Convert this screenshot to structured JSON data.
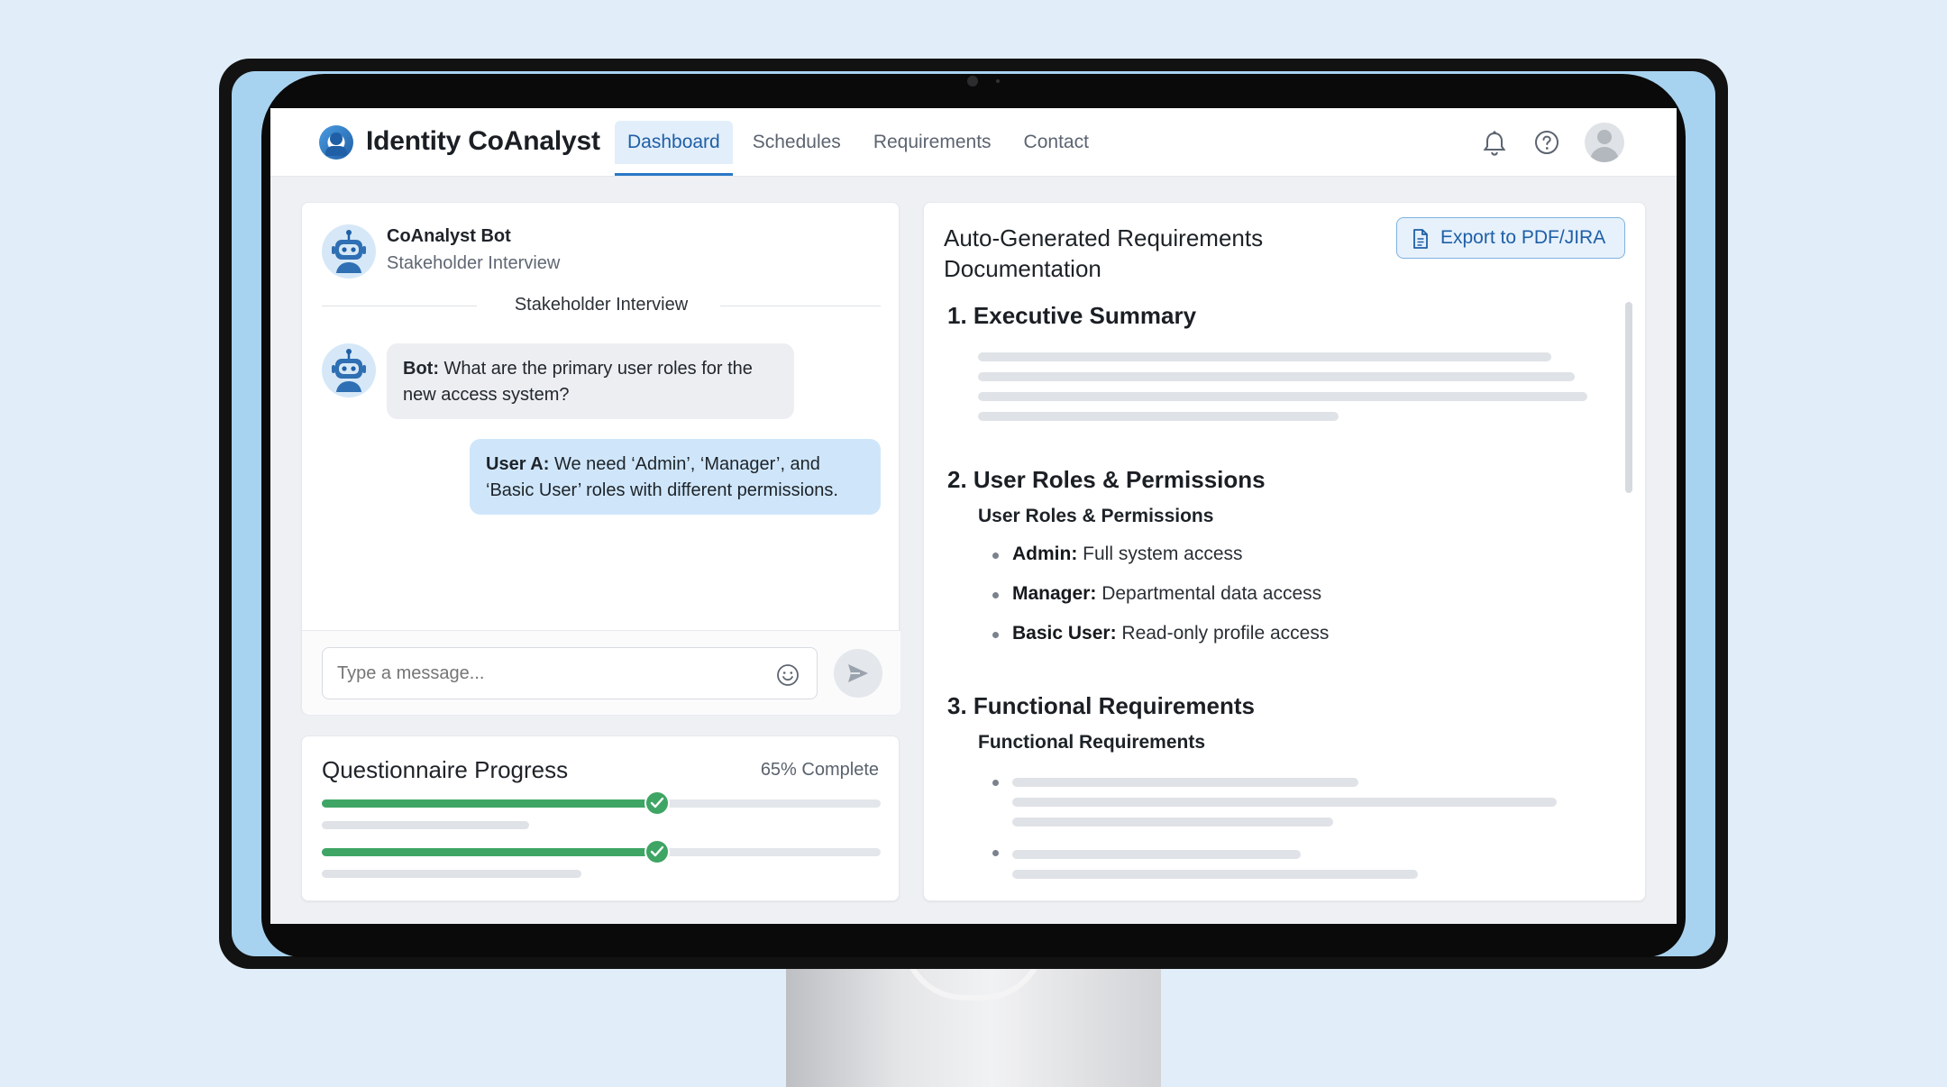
{
  "app": {
    "title": "Identity CoAnalyst",
    "tabs": [
      "Dashboard",
      "Schedules",
      "Requirements",
      "Contact"
    ],
    "active_tab": "Dashboard"
  },
  "chat": {
    "bot_name": "CoAnalyst Bot",
    "bot_subtitle": "Stakeholder Interview",
    "divider_label": "Stakeholder Interview",
    "messages": [
      {
        "speaker": "Bot:",
        "text": " What are the primary user roles for the new access system?"
      },
      {
        "speaker": "User A:",
        "text": " We need ‘Admin’, ‘Manager’, and ‘Basic User’ roles with different permissions."
      }
    ],
    "input_placeholder": "Type a message..."
  },
  "progress": {
    "title": "Questionnaire Progress",
    "percent_label": "65% Complete",
    "bars": [
      0.6,
      0.6
    ]
  },
  "doc": {
    "title": "Auto-Generated Requirements Documentation",
    "export_label": "Export to PDF/JIRA",
    "sections": [
      {
        "heading": "1. Executive Summary"
      },
      {
        "heading": "2. User Roles & Permissions",
        "subheading": "User Roles & Permissions",
        "items": [
          {
            "term": "Admin:",
            "desc": " Full system access"
          },
          {
            "term": "Manager:",
            "desc": " Departmental data access"
          },
          {
            "term": "Basic User:",
            "desc": " Read-only profile access"
          }
        ]
      },
      {
        "heading": "3. Functional Requirements",
        "subheading": "Functional Requirements"
      }
    ]
  },
  "colors": {
    "accent": "#1f5fa6",
    "progress": "#3ea564",
    "user_bubble": "#cfe6fa"
  }
}
